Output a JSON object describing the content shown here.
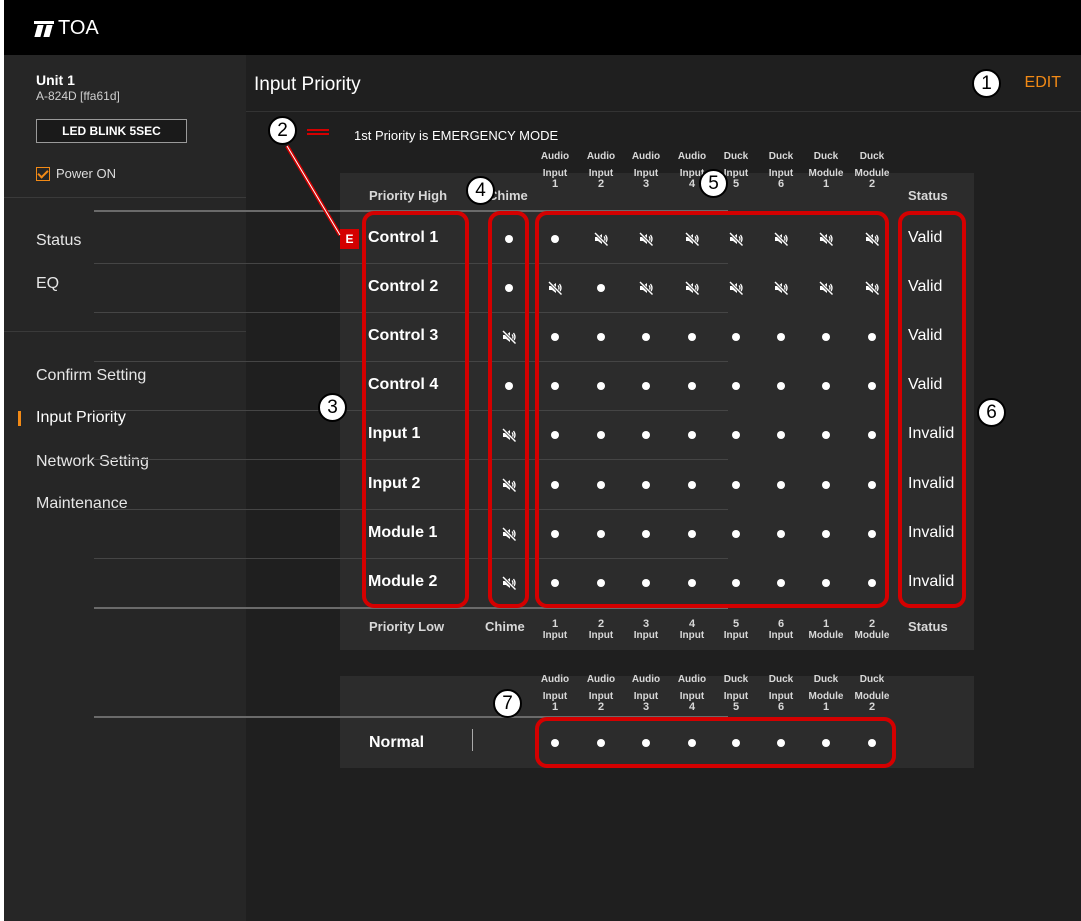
{
  "brand": {
    "logo_text": "TOA"
  },
  "sidebar": {
    "unit_name": "Unit 1",
    "unit_model": "A-824D [ffa61d]",
    "led_button": "LED BLINK 5SEC",
    "power_label": "Power ON",
    "power_checked": true,
    "nav_top": [
      {
        "label": "Status"
      },
      {
        "label": "EQ"
      }
    ],
    "nav_bottom": [
      {
        "label": "Confirm Setting",
        "active": false
      },
      {
        "label": "Input Priority",
        "active": true
      },
      {
        "label": "Network Setting",
        "active": false
      },
      {
        "label": "Maintenance",
        "active": false
      }
    ]
  },
  "header": {
    "title": "Input Priority",
    "edit_label": "EDIT"
  },
  "emergency_note": "1st Priority is EMERGENCY MODE",
  "emergency_badge": "E",
  "table": {
    "header_high": "Priority High",
    "header_low": "Priority Low",
    "chime_label": "Chime",
    "status_label": "Status",
    "top_columns": [
      {
        "l1": "Audio",
        "l2": "Input",
        "n": "1"
      },
      {
        "l1": "Audio",
        "l2": "Input",
        "n": "2"
      },
      {
        "l1": "Audio",
        "l2": "Input",
        "n": "3"
      },
      {
        "l1": "Audio",
        "l2": "Input",
        "n": "4"
      },
      {
        "l1": "Duck",
        "l2": "Input",
        "n": "5"
      },
      {
        "l1": "Duck",
        "l2": "Input",
        "n": "6"
      },
      {
        "l1": "Duck",
        "l2": "Module",
        "n": "1"
      },
      {
        "l1": "Duck",
        "l2": "Module",
        "n": "2"
      }
    ],
    "bottom_columns": [
      {
        "n": "1",
        "l": "Input"
      },
      {
        "n": "2",
        "l": "Input"
      },
      {
        "n": "3",
        "l": "Input"
      },
      {
        "n": "4",
        "l": "Input"
      },
      {
        "n": "5",
        "l": "Input"
      },
      {
        "n": "6",
        "l": "Input"
      },
      {
        "n": "1",
        "l": "Module"
      },
      {
        "n": "2",
        "l": "Module"
      }
    ],
    "rows": [
      {
        "label": "Control 1",
        "chime": "dot",
        "cells": [
          "dot",
          "mute",
          "mute",
          "mute",
          "mute",
          "mute",
          "mute",
          "mute"
        ],
        "status": "Valid"
      },
      {
        "label": "Control 2",
        "chime": "dot",
        "cells": [
          "mute",
          "dot",
          "mute",
          "mute",
          "mute",
          "mute",
          "mute",
          "mute"
        ],
        "status": "Valid"
      },
      {
        "label": "Control 3",
        "chime": "mute",
        "cells": [
          "dot",
          "dot",
          "dot",
          "dot",
          "dot",
          "dot",
          "dot",
          "dot"
        ],
        "status": "Valid"
      },
      {
        "label": "Control 4",
        "chime": "dot",
        "cells": [
          "dot",
          "dot",
          "dot",
          "dot",
          "dot",
          "dot",
          "dot",
          "dot"
        ],
        "status": "Valid"
      },
      {
        "label": "Input 1",
        "chime": "mute",
        "cells": [
          "dot",
          "dot",
          "dot",
          "dot",
          "dot",
          "dot",
          "dot",
          "dot"
        ],
        "status": "Invalid"
      },
      {
        "label": "Input 2",
        "chime": "mute",
        "cells": [
          "dot",
          "dot",
          "dot",
          "dot",
          "dot",
          "dot",
          "dot",
          "dot"
        ],
        "status": "Invalid"
      },
      {
        "label": "Module 1",
        "chime": "mute",
        "cells": [
          "dot",
          "dot",
          "dot",
          "dot",
          "dot",
          "dot",
          "dot",
          "dot"
        ],
        "status": "Invalid"
      },
      {
        "label": "Module 2",
        "chime": "mute",
        "cells": [
          "dot",
          "dot",
          "dot",
          "dot",
          "dot",
          "dot",
          "dot",
          "dot"
        ],
        "status": "Invalid"
      }
    ]
  },
  "normal": {
    "label": "Normal",
    "cells": [
      "dot",
      "dot",
      "dot",
      "dot",
      "dot",
      "dot",
      "dot",
      "dot"
    ]
  },
  "callouts": [
    "1",
    "2",
    "3",
    "4",
    "5",
    "6",
    "7"
  ],
  "colors": {
    "accent": "#f28a16",
    "highlight": "#d40000",
    "panel": "#2c2c2c",
    "background": "#1f1f1f"
  }
}
